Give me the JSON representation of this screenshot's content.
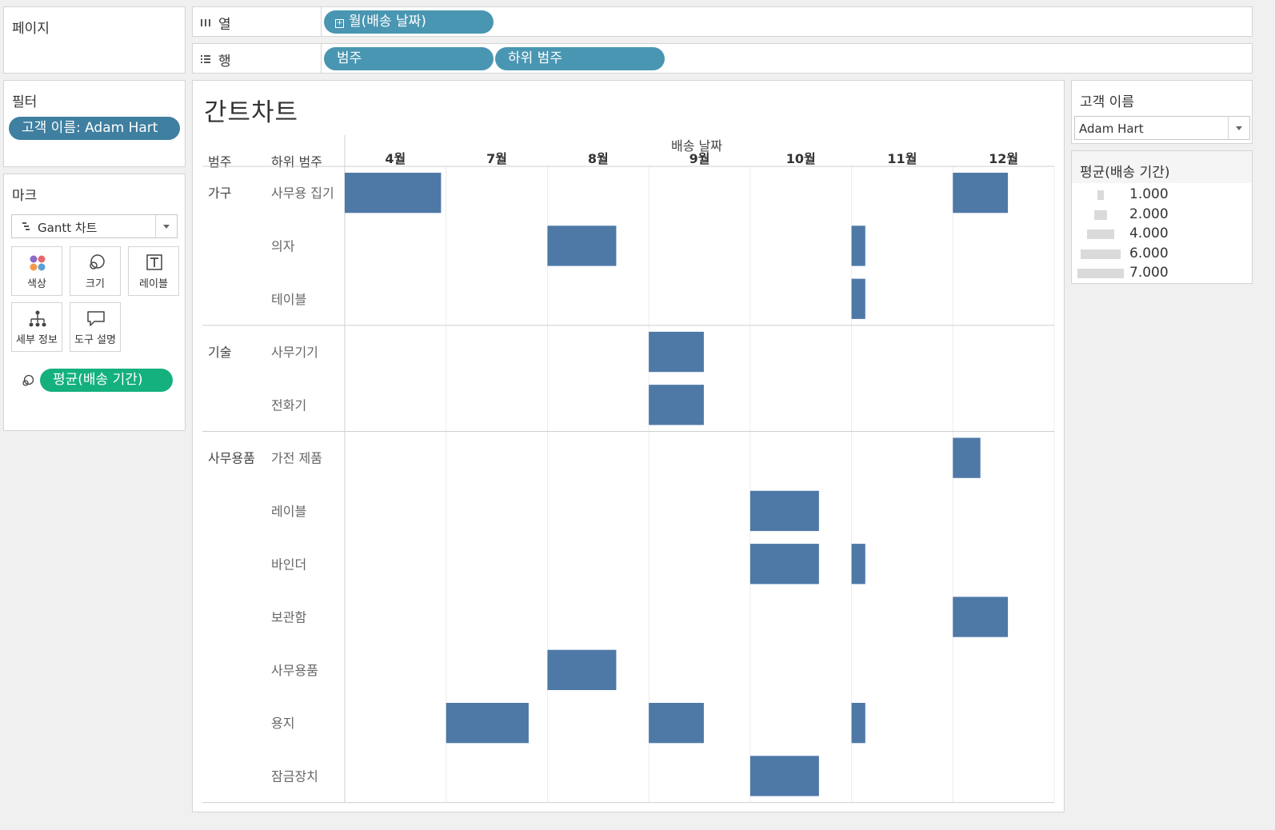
{
  "pages_panel": {
    "title": "페이지"
  },
  "shelves": {
    "columns": {
      "label": "열",
      "icon": "columns-icon",
      "pills": [
        "월(배송 날짜)"
      ]
    },
    "rows": {
      "label": "행",
      "icon": "rows-icon",
      "pills": [
        "범주",
        "하위 범주"
      ]
    }
  },
  "filters_panel": {
    "title": "필터",
    "pills": [
      "고객 이름: Adam Hart"
    ]
  },
  "marks_panel": {
    "title": "마크",
    "mark_type": "Gantt 차트",
    "buttons": [
      {
        "label": "색상",
        "icon": "color-icon"
      },
      {
        "label": "크기",
        "icon": "size-icon"
      },
      {
        "label": "레이블",
        "icon": "label-icon"
      },
      {
        "label": "세부 정보",
        "icon": "detail-icon"
      },
      {
        "label": "도구 설명",
        "icon": "tooltip-icon"
      }
    ],
    "size_pill": "평균(배송 기간)"
  },
  "customer_filter": {
    "title": "고객 이름",
    "selected": "Adam Hart"
  },
  "size_legend": {
    "title": "평균(배송 기간)",
    "items": [
      "1.000",
      "2.000",
      "4.000",
      "6.000",
      "7.000"
    ],
    "values": [
      1,
      2,
      4,
      6,
      7
    ]
  },
  "colors": {
    "bar": "#4e79a7",
    "pill_blue": "#4996b2",
    "pill_dark": "#3f7fa0",
    "pill_green": "#14b07e"
  },
  "chart_data": {
    "type": "gantt",
    "title": "간트차트",
    "col_header_title": "배송 날짜",
    "row_header_labels": [
      "범주",
      "하위 범주"
    ],
    "months": [
      "4월",
      "7월",
      "8월",
      "9월",
      "10월",
      "11월",
      "12월"
    ],
    "categories": [
      {
        "name": "가구",
        "subcategories": [
          "사무용 집기",
          "의자",
          "테이블"
        ]
      },
      {
        "name": "기술",
        "subcategories": [
          "사무기기",
          "전화기"
        ]
      },
      {
        "name": "사무용품",
        "subcategories": [
          "가전 제품",
          "레이블",
          "바인더",
          "보관함",
          "사무용품",
          "용지",
          "잠금장치"
        ]
      }
    ],
    "bars": [
      {
        "category": "가구",
        "subcategory": "사무용 집기",
        "month": "4월",
        "avg_shipping_days": 7
      },
      {
        "category": "가구",
        "subcategory": "사무용 집기",
        "month": "12월",
        "avg_shipping_days": 4
      },
      {
        "category": "가구",
        "subcategory": "의자",
        "month": "8월",
        "avg_shipping_days": 5
      },
      {
        "category": "가구",
        "subcategory": "의자",
        "month": "11월",
        "avg_shipping_days": 1
      },
      {
        "category": "가구",
        "subcategory": "테이블",
        "month": "11월",
        "avg_shipping_days": 1
      },
      {
        "category": "기술",
        "subcategory": "사무기기",
        "month": "9월",
        "avg_shipping_days": 4
      },
      {
        "category": "기술",
        "subcategory": "전화기",
        "month": "9월",
        "avg_shipping_days": 4
      },
      {
        "category": "사무용품",
        "subcategory": "가전 제품",
        "month": "12월",
        "avg_shipping_days": 2
      },
      {
        "category": "사무용품",
        "subcategory": "레이블",
        "month": "10월",
        "avg_shipping_days": 5
      },
      {
        "category": "사무용품",
        "subcategory": "바인더",
        "month": "10월",
        "avg_shipping_days": 5
      },
      {
        "category": "사무용품",
        "subcategory": "바인더",
        "month": "11월",
        "avg_shipping_days": 1
      },
      {
        "category": "사무용품",
        "subcategory": "보관함",
        "month": "12월",
        "avg_shipping_days": 4
      },
      {
        "category": "사무용품",
        "subcategory": "사무용품",
        "month": "8월",
        "avg_shipping_days": 5
      },
      {
        "category": "사무용품",
        "subcategory": "용지",
        "month": "7월",
        "avg_shipping_days": 6
      },
      {
        "category": "사무용품",
        "subcategory": "용지",
        "month": "9월",
        "avg_shipping_days": 4
      },
      {
        "category": "사무용품",
        "subcategory": "용지",
        "month": "11월",
        "avg_shipping_days": 1
      },
      {
        "category": "사무용품",
        "subcategory": "잠금장치",
        "month": "10월",
        "avg_shipping_days": 5
      }
    ],
    "grid": true,
    "legend_position": "right"
  }
}
